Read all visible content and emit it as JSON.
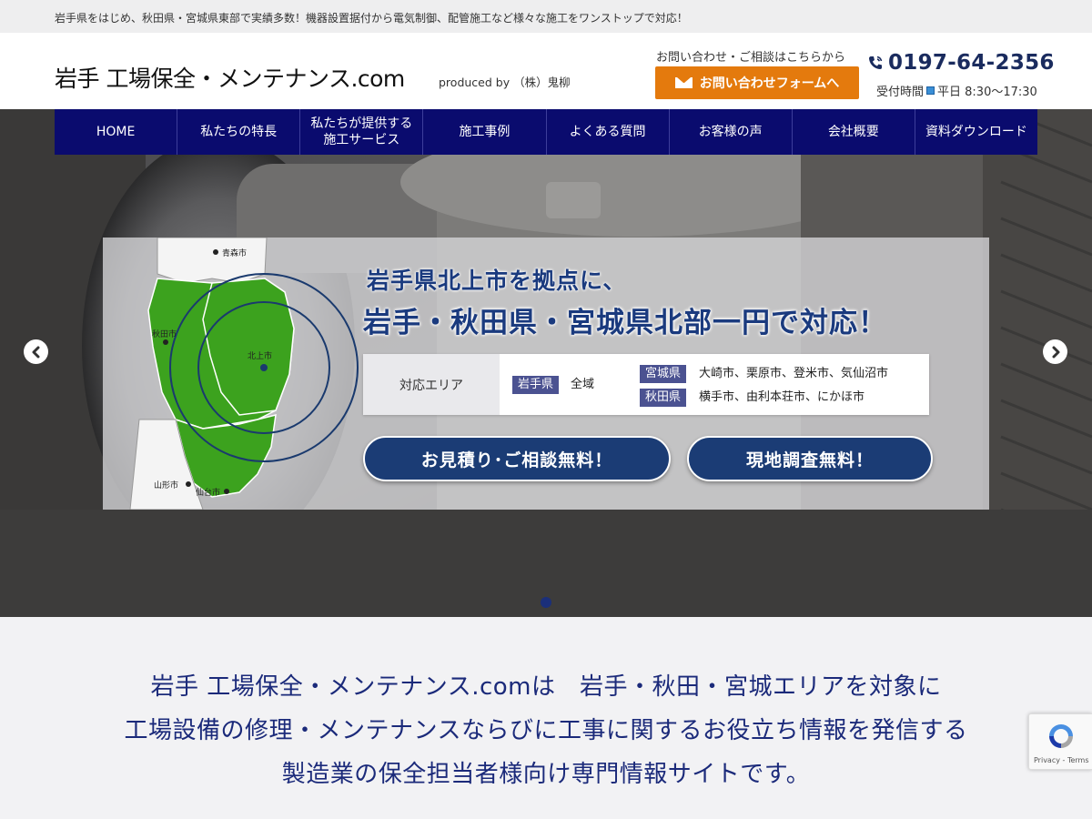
{
  "topbar": {
    "text": "岩手県をはじめ、秋田県・宮城県東部で実績多数！機器設置据付から電気制御、配管施工など様々な施工をワンストップで対応！"
  },
  "header": {
    "site_title": "岩手 工場保全・メンテナンス.com",
    "produced_by": "produced by （株）鬼柳",
    "contact_label": "お問い合わせ・ご相談はこちらから",
    "contact_button": "お問い合わせフォームへ",
    "phone": "0197-64-2356",
    "hours_label": "受付時間",
    "hours_value": "平日 8:30〜17:30"
  },
  "nav": {
    "items": [
      {
        "label": "HOME"
      },
      {
        "label": "私たちの特長"
      },
      {
        "label": "私たちが提供する\n施工サービス"
      },
      {
        "label": "施工事例"
      },
      {
        "label": "よくある質問"
      },
      {
        "label": "お客様の声"
      },
      {
        "label": "会社概要"
      },
      {
        "label": "資料ダウンロード"
      }
    ]
  },
  "hero": {
    "headline_1": "岩手県北上市を拠点に、",
    "headline_2": "岩手・秋田県・宮城県北部一円で対応！",
    "map_cities": {
      "aomori": "青森市",
      "akita": "秋田市",
      "kitakami": "北上市",
      "yamagata": "山形市",
      "sendai": "仙台市"
    },
    "area": {
      "label": "対応エリア",
      "iwate_tag": "岩手県",
      "iwate_text": "全域",
      "miyagi_tag": "宮城県",
      "miyagi_text": "大崎市、栗原市、登米市、気仙沼市",
      "akita_tag": "秋田県",
      "akita_text": "横手市、由利本荘市、にかほ市"
    },
    "cta_1": "お見積り･ご相談無料！",
    "cta_2": "現地調査無料！"
  },
  "intro": {
    "line_1": "岩手 工場保全・メンテナンス.comは　岩手・秋田・宮城エリアを対象に",
    "line_2": "工場設備の修理・メンテナンスならびに工事に関するお役立ち情報を発信する",
    "line_3": "製造業の保全担当者様向け専門情報サイトです。"
  },
  "recaptcha": {
    "links": "Privacy - Terms"
  },
  "colors": {
    "nav_bg": "#0a0b6e",
    "accent_orange": "#e47a0d",
    "brand_navy": "#1a2b5e",
    "map_green": "#3ca21e",
    "intro_text": "#1b2a7a"
  },
  "icons": [
    "mail-icon",
    "phone-icon",
    "chevron-left-icon",
    "chevron-right-icon",
    "recaptcha-icon"
  ]
}
